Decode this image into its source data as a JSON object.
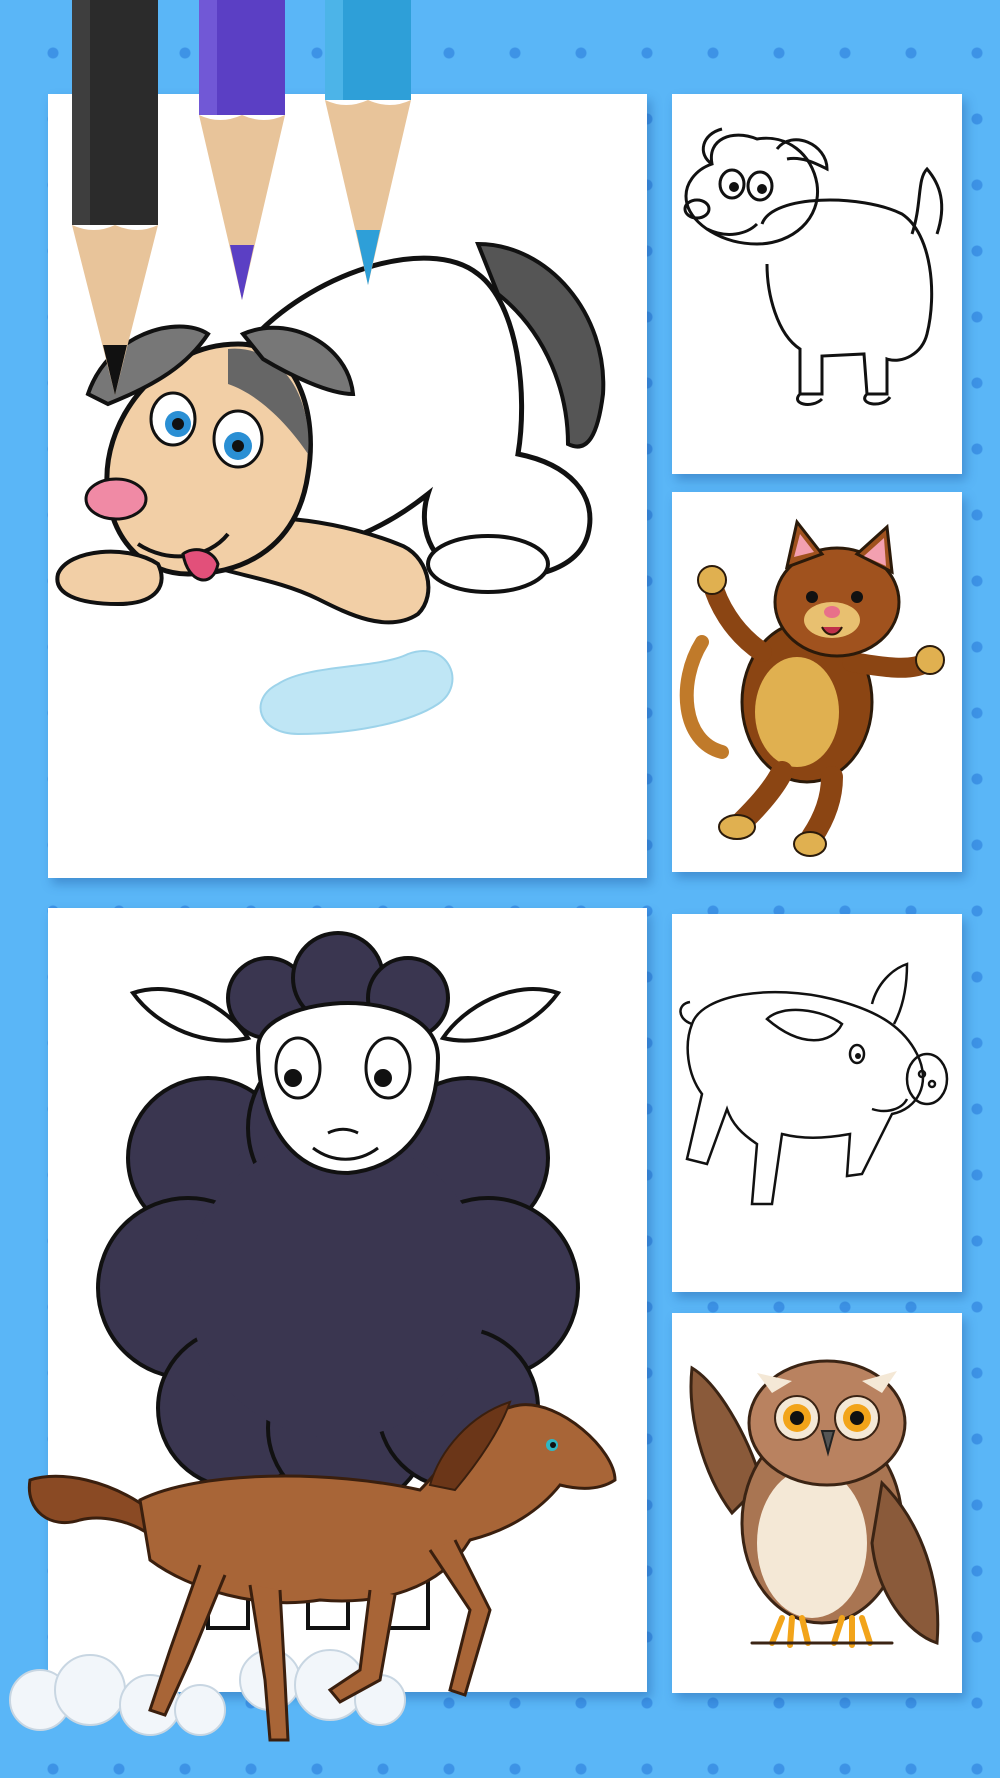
{
  "screen": {
    "background_color": "#5ab6f7",
    "dot_color": "#3d93e6"
  },
  "pencils": [
    {
      "name": "black-pencil",
      "color": "#2b2b2b"
    },
    {
      "name": "purple-pencil",
      "color": "#5b3fc4"
    },
    {
      "name": "blue-pencil",
      "color": "#2e9fd8"
    }
  ],
  "gallery": {
    "items": [
      {
        "id": "dog-colored",
        "style": "colored"
      },
      {
        "id": "dog-outline",
        "style": "line-art"
      },
      {
        "id": "cat-colored",
        "style": "colored"
      },
      {
        "id": "sheep-colored",
        "style": "colored"
      },
      {
        "id": "pig-outline",
        "style": "line-art"
      },
      {
        "id": "owl-colored",
        "style": "colored"
      }
    ]
  },
  "decorations": {
    "horse": "running-horse-icon",
    "clouds": "cloud-icon"
  }
}
